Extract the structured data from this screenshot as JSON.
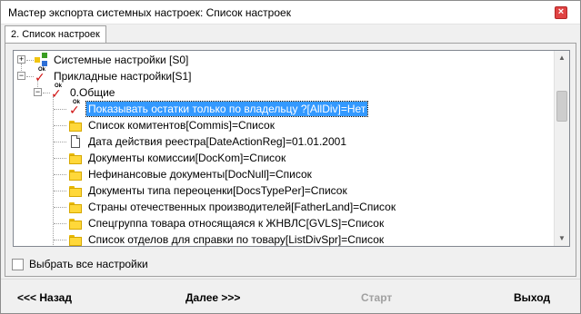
{
  "window": {
    "title": "Мастер экспорта системных настроек:  Список настроек",
    "close_label": "×"
  },
  "tabs": [
    {
      "label": "2. Список настроек",
      "active": true
    }
  ],
  "tree": {
    "nodes": [
      {
        "label": "Системные настройки [S0]",
        "icon": "system-settings-icon",
        "expander": "+"
      },
      {
        "label": "Прикладные настройки[S1]",
        "icon": "ok-check-icon",
        "expander": "−"
      },
      {
        "label": "0.Общие",
        "icon": "ok-check-icon",
        "expander": "−"
      },
      {
        "label": "Показывать остатки только по владельцу ?[AllDiv]=Нет",
        "icon": "ok-check-icon",
        "selected": true
      },
      {
        "label": "Список комитентов[Commis]=Список",
        "icon": "folder-icon"
      },
      {
        "label": "Дата действия реестра[DateActionReg]=01.01.2001",
        "icon": "document-icon"
      },
      {
        "label": "Документы комиссии[DocKom]=Список",
        "icon": "folder-icon"
      },
      {
        "label": "Нефинансовые документы[DocNull]=Список",
        "icon": "folder-icon"
      },
      {
        "label": "Документы типа переоценки[DocsTypePer]=Список",
        "icon": "folder-icon"
      },
      {
        "label": "Страны отечественных производителей[FatherLand]=Список",
        "icon": "folder-icon"
      },
      {
        "label": "Спецгруппа товара относящаяся к ЖНВЛС[GVLS]=Список",
        "icon": "folder-icon"
      },
      {
        "label": "Список отделов для справки по товару[ListDivSpr]=Список",
        "icon": "folder-icon"
      }
    ]
  },
  "select_all": {
    "label": "Выбрать все настройки",
    "checked": false
  },
  "buttons": {
    "back": "<<< Назад",
    "next": "Далее >>>",
    "start": "Старт",
    "exit": "Выход"
  },
  "colors": {
    "selection": "#3399ff",
    "folder": "#ffd83a",
    "check_red": "#d01010"
  }
}
